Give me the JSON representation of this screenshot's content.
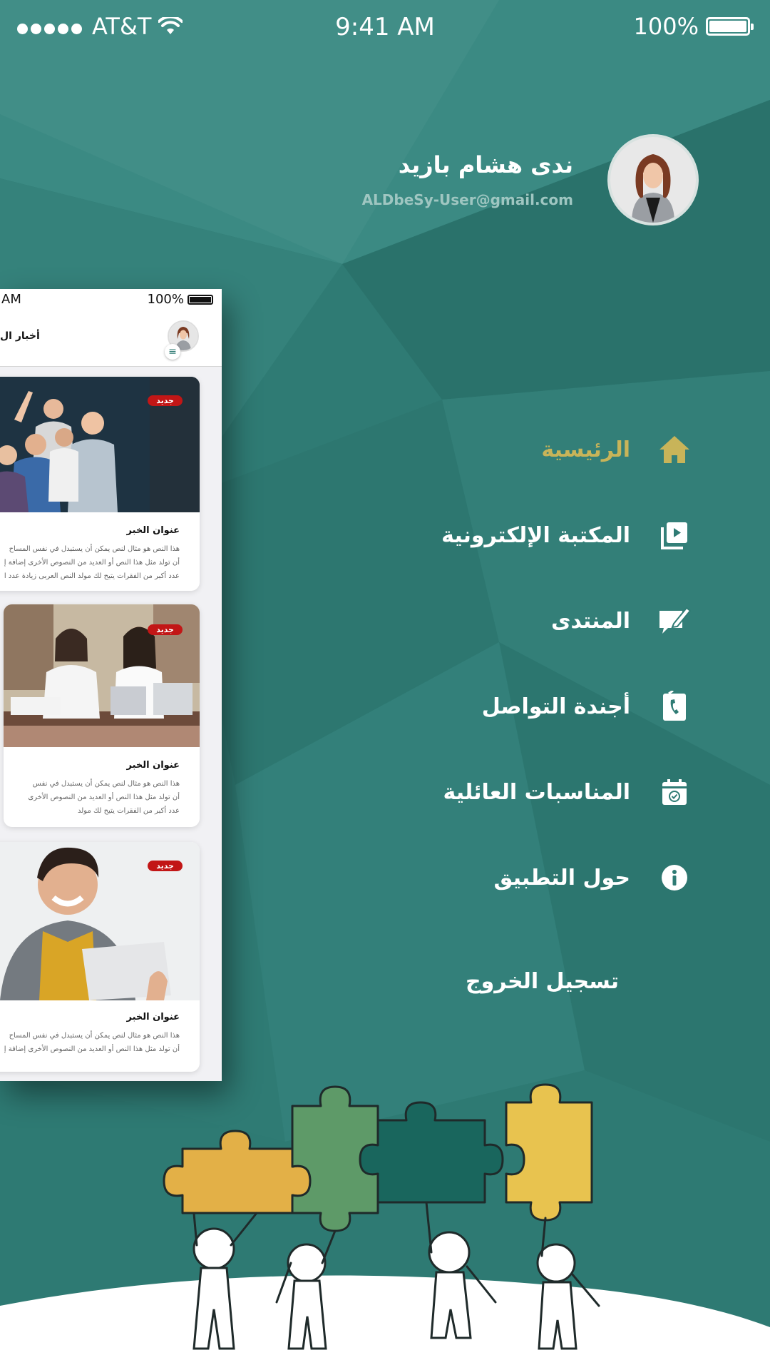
{
  "status_bar": {
    "carrier": "AT&T",
    "time": "9:41 AM",
    "battery": "100%"
  },
  "profile": {
    "name": "ندى هشام بازيد",
    "email": "ALDbeSy-User@gmail.com"
  },
  "menu": {
    "items": [
      {
        "label": "الرئيسية",
        "icon": "home-icon",
        "active": true
      },
      {
        "label": "المكتبة الإلكترونية",
        "icon": "video-library-icon",
        "active": false
      },
      {
        "label": "المنتدى",
        "icon": "forum-edit-icon",
        "active": false
      },
      {
        "label": "أجندة التواصل",
        "icon": "contact-book-icon",
        "active": false
      },
      {
        "label": "المناسبات العائلية",
        "icon": "calendar-check-icon",
        "active": false
      },
      {
        "label": "حول التطبيق",
        "icon": "info-icon",
        "active": false
      }
    ],
    "logout": "تسجيل الخروج"
  },
  "preview": {
    "time": "AM",
    "battery": "100%",
    "title": "أخبار ال",
    "cards": [
      {
        "badge": "جديد",
        "title": "عنوان الخبر",
        "lines": [
          "هذا النص هو مثال لنص يمكن أن يستبدل في نفس المساح",
          "أن تولد مثل هذا النص أو العديد من النصوص الأخرى إضافة إ",
          "عدد أكبر من الفقرات يتيح لك مولد النص العربى زيادة عدد ا"
        ]
      },
      {
        "badge": "جديد",
        "title": "عنوان الخبر",
        "lines": [
          "هذا النص هو مثال لنص يمكن أن يستبدل في نفس",
          "أن تولد مثل هذا النص أو العديد من النصوص الأخرى",
          "عدد أكبر من الفقرات يتيح لك مولد"
        ]
      },
      {
        "badge": "جديد",
        "title": "عنوان الخبر",
        "lines": [
          "هذا النص هو مثال لنص يمكن أن يستبدل في نفس المساح",
          "أن تولد مثل هذا النص أو العديد من النصوص الأخرى إضافة إ"
        ]
      }
    ]
  },
  "colors": {
    "background": "#2f7b74",
    "active": "#c8b459",
    "badge": "#c21616"
  }
}
